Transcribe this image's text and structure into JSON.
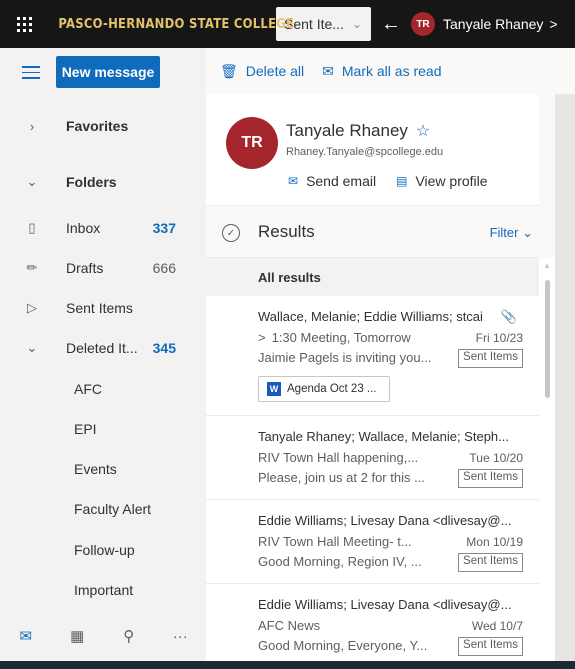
{
  "topbar": {
    "org_name": "PASCO-HERNANDO STATE COLLEGE",
    "search_scope": "Sent Ite...",
    "person_initials": "TR",
    "person_name": "Tanyale Rhaney",
    "more": ">"
  },
  "nav": {
    "new_message": "New message",
    "favorites": "Favorites",
    "folders": "Folders",
    "items": [
      {
        "label": "Inbox",
        "count": "337"
      },
      {
        "label": "Drafts",
        "count": "666"
      },
      {
        "label": "Sent Items",
        "count": ""
      },
      {
        "label": "Deleted It...",
        "count": "345"
      }
    ],
    "subfolders": [
      "AFC",
      "EPI",
      "Events",
      "Faculty Alert",
      "Follow-up",
      "Important"
    ],
    "bottom_more": "···"
  },
  "commands": {
    "delete_all": "Delete all",
    "mark_all_read": "Mark all as read"
  },
  "contact": {
    "initials": "TR",
    "name": "Tanyale Rhaney",
    "email": "Rhaney.Tanyale@spcollege.edu",
    "send_email": "Send email",
    "view_profile": "View profile"
  },
  "results": {
    "title": "Results",
    "filter": "Filter",
    "all_results": "All results"
  },
  "messages": [
    {
      "from": "Wallace, Melanie; Eddie Williams; stcai",
      "subject": "1:30 Meeting, Tomorrow",
      "date": "Fri 10/23",
      "preview": "Jaimie Pagels is inviting you...",
      "folder": "Sent Items",
      "attachment": "Agenda Oct 23 ..."
    },
    {
      "from": "Tanyale Rhaney; Wallace, Melanie; Steph...",
      "subject": "RIV Town Hall happening,...",
      "date": "Tue 10/20",
      "preview": "Please, join us at 2 for this ...",
      "folder": "Sent Items"
    },
    {
      "from": "Eddie Williams; Livesay Dana <dlivesay@...",
      "subject": "RIV Town Hall Meeting- t...",
      "date": "Mon 10/19",
      "preview": "Good Morning, Region IV, ...",
      "folder": "Sent Items"
    },
    {
      "from": "Eddie Williams; Livesay Dana <dlivesay@...",
      "subject": "AFC News",
      "date": "Wed 10/7",
      "preview": "Good Morning, Everyone, Y...",
      "folder": "Sent Items"
    }
  ],
  "colors": {
    "accent": "#0f6cbd",
    "avatar": "#a4262c",
    "topbar": "#161616",
    "org_gold": "#e4c26b"
  }
}
